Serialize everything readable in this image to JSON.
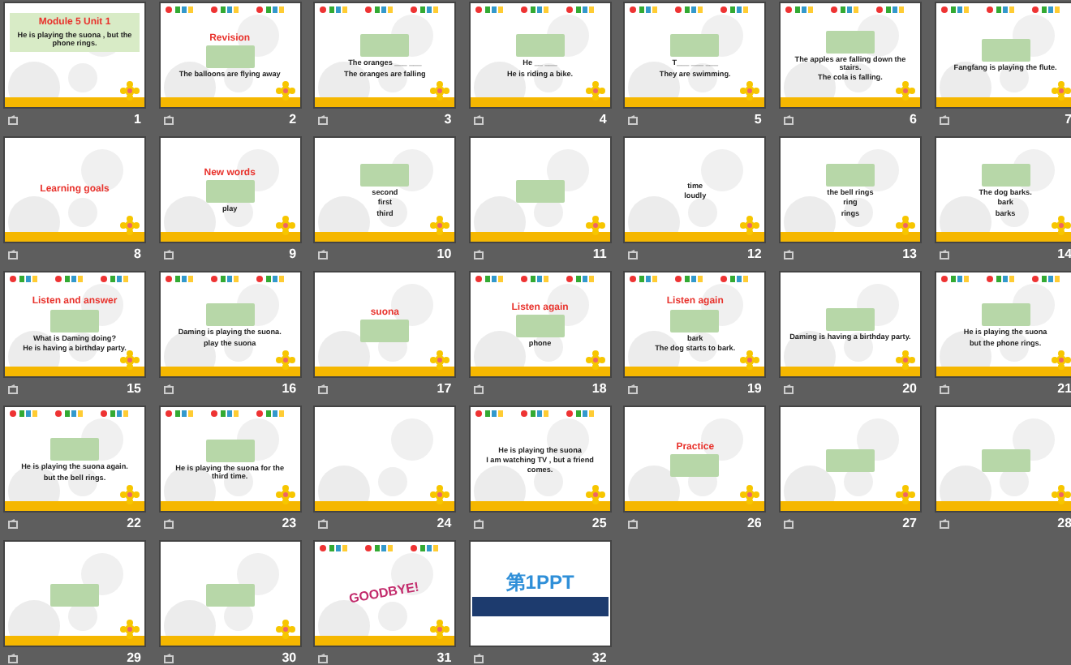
{
  "slides": [
    {
      "number": "1",
      "kind": "title",
      "picture": false,
      "title": "Module 5 Unit 1",
      "lines": [
        "He is playing the suona , but the phone rings."
      ]
    },
    {
      "number": "2",
      "kind": "standard",
      "picture": true,
      "title": "Revision",
      "lines": [
        "The balloons are flying away"
      ]
    },
    {
      "number": "3",
      "kind": "standard",
      "picture": true,
      "lines": [
        "The oranges ___ ___",
        "The oranges are falling"
      ]
    },
    {
      "number": "4",
      "kind": "standard",
      "picture": true,
      "lines": [
        "He __ ___",
        "He is riding a bike."
      ]
    },
    {
      "number": "5",
      "kind": "standard",
      "picture": true,
      "lines": [
        "T___ ___ ___",
        "They are swimming."
      ]
    },
    {
      "number": "6",
      "kind": "standard",
      "picture": true,
      "lines": [
        "The apples are falling down the stairs.",
        "The cola is falling."
      ]
    },
    {
      "number": "7",
      "kind": "standard",
      "picture": true,
      "lines": [
        "Fangfang is playing the flute."
      ]
    },
    {
      "number": "8",
      "kind": "plain",
      "picture": false,
      "title": "Learning goals"
    },
    {
      "number": "9",
      "kind": "plain",
      "picture": true,
      "title": "New words",
      "lines": [
        "play"
      ]
    },
    {
      "number": "10",
      "kind": "plain",
      "picture": true,
      "lines": [
        "second",
        "first",
        "third"
      ]
    },
    {
      "number": "11",
      "kind": "plain",
      "picture": true
    },
    {
      "number": "12",
      "kind": "plain",
      "picture": false,
      "lines": [
        "time",
        "loudly"
      ]
    },
    {
      "number": "13",
      "kind": "plain",
      "picture": true,
      "lines": [
        "the bell rings",
        "ring",
        "rings"
      ]
    },
    {
      "number": "14",
      "kind": "plain",
      "picture": true,
      "lines": [
        "The dog barks.",
        "bark",
        "barks"
      ]
    },
    {
      "number": "15",
      "kind": "standard",
      "picture": true,
      "title": "Listen and answer",
      "lines": [
        "What is Daming doing?",
        "He is having a birthday party."
      ]
    },
    {
      "number": "16",
      "kind": "standard",
      "picture": true,
      "lines": [
        "Daming is playing the suona.",
        "play the suona"
      ]
    },
    {
      "number": "17",
      "kind": "plain",
      "picture": true,
      "title": "suona"
    },
    {
      "number": "18",
      "kind": "standard",
      "picture": true,
      "title": "Listen again",
      "lines": [
        "phone"
      ]
    },
    {
      "number": "19",
      "kind": "standard",
      "picture": true,
      "title": "Listen again",
      "lines": [
        "bark",
        "The dog starts to bark."
      ]
    },
    {
      "number": "20",
      "kind": "plain",
      "picture": true,
      "lines": [
        "Daming is having a birthday party."
      ]
    },
    {
      "number": "21",
      "kind": "standard",
      "picture": true,
      "lines": [
        "He is playing the suona",
        "but the phone rings."
      ]
    },
    {
      "number": "22",
      "kind": "standard",
      "picture": true,
      "lines": [
        "He is playing the suona again.",
        "but the bell rings."
      ]
    },
    {
      "number": "23",
      "kind": "standard",
      "picture": true,
      "lines": [
        "He is playing the suona for the third time."
      ]
    },
    {
      "number": "24",
      "kind": "plain",
      "picture": false
    },
    {
      "number": "25",
      "kind": "standard",
      "picture": false,
      "lines": [
        "He is playing the suona",
        "I am watching TV , but a friend comes."
      ]
    },
    {
      "number": "26",
      "kind": "plain",
      "picture": true,
      "title": "Practice"
    },
    {
      "number": "27",
      "kind": "plain",
      "picture": true
    },
    {
      "number": "28",
      "kind": "plain",
      "picture": true
    },
    {
      "number": "29",
      "kind": "plain",
      "picture": true
    },
    {
      "number": "30",
      "kind": "plain",
      "picture": true
    },
    {
      "number": "31",
      "kind": "standard",
      "picture": false,
      "title": "GOODBYE!"
    },
    {
      "number": "32",
      "kind": "brand",
      "picture": false,
      "title": "第1PPT"
    }
  ]
}
